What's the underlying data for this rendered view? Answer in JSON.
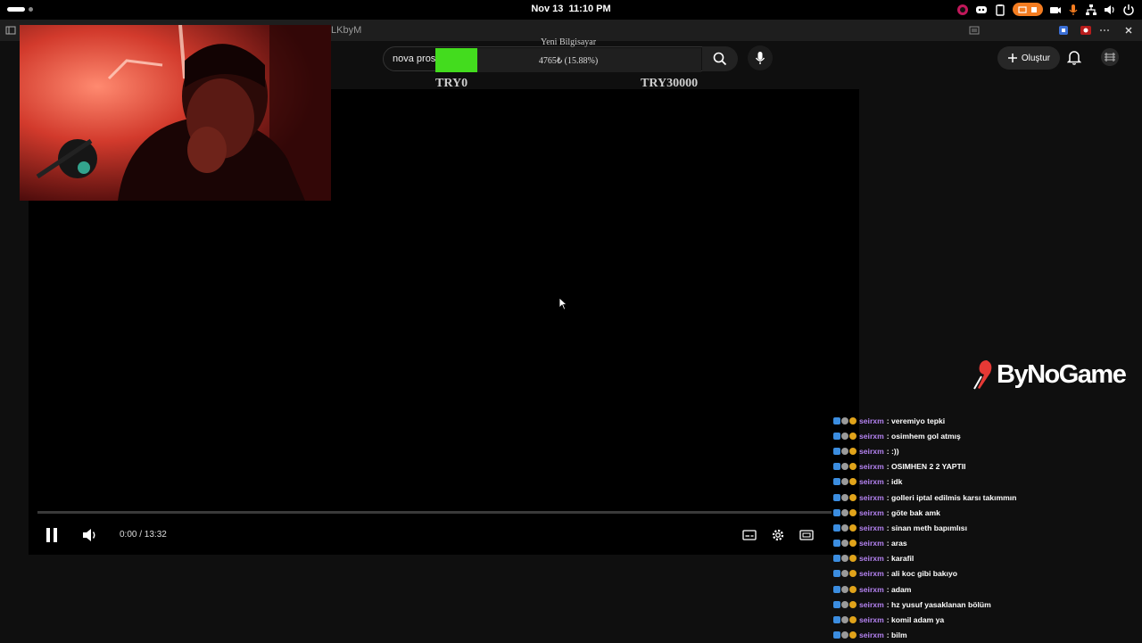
{
  "system": {
    "date": "Nov 13",
    "time": "11:10 PM"
  },
  "browser": {
    "tab_title": "LKbyM"
  },
  "youtube": {
    "search_value": "nova prosp",
    "create_label": "Oluştur"
  },
  "goal": {
    "title": "Yeni Bilgisayar",
    "progress_label": "4765₺ (15.88%)",
    "fraction": 0.1588,
    "min_label": "TRY0",
    "max_label": "TRY30000",
    "fill_color": "#43dc1e"
  },
  "player": {
    "time_display": "0:00 / 13:32",
    "icons": [
      "pause-icon",
      "volume-icon",
      "subtitles-icon",
      "settings-icon",
      "theater-mode-icon"
    ]
  },
  "sponsor": {
    "name": "ByNoGame",
    "accent_color": "#e53935"
  },
  "chat": {
    "username_color": "#b583f2",
    "messages": [
      {
        "user": "seirxm",
        "text": ": veremiyo tepki"
      },
      {
        "user": "seirxm",
        "text": ": osimhem gol atmış"
      },
      {
        "user": "seirxm",
        "text": ": :))"
      },
      {
        "user": "seirxm",
        "text": ": OSIMHEN 2 2 YAPTII"
      },
      {
        "user": "seirxm",
        "text": ": idk"
      },
      {
        "user": "seirxm",
        "text": ": golleri iptal edilmis karsı takımmın"
      },
      {
        "user": "seirxm",
        "text": ": göte bak amk"
      },
      {
        "user": "seirxm",
        "text": ": sinan meth bapımlısı"
      },
      {
        "user": "seirxm",
        "text": ": aras"
      },
      {
        "user": "seirxm",
        "text": ": karafil"
      },
      {
        "user": "seirxm",
        "text": ": ali koc gibi bakıyo"
      },
      {
        "user": "seirxm",
        "text": ": adam"
      },
      {
        "user": "seirxm",
        "text": ": hz yusuf yasaklanan bölüm"
      },
      {
        "user": "seirxm",
        "text": ": komil adam ya"
      },
      {
        "user": "seirxm",
        "text": ": bilm"
      }
    ]
  }
}
